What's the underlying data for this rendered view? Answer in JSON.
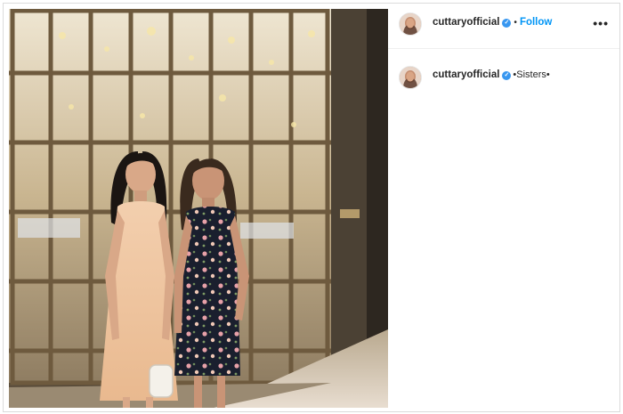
{
  "post": {
    "username": "cuttaryofficial",
    "verified_icon": "verified-badge-icon",
    "separator": "•",
    "follow_label": "Follow",
    "more_label": "•••",
    "caption": "•Sisters•"
  },
  "colors": {
    "follow": "#0095f6",
    "verified": "#3897f0",
    "text": "#262626"
  }
}
